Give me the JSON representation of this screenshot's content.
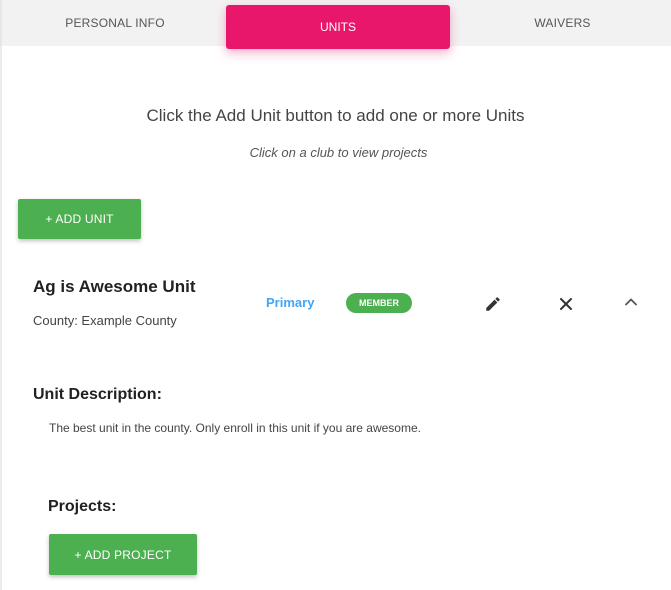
{
  "tabs": [
    {
      "label": "PERSONAL INFO",
      "active": false
    },
    {
      "label": "UNITS",
      "active": true
    },
    {
      "label": "WAIVERS",
      "active": false
    }
  ],
  "intro": {
    "title": "Click the Add Unit button to add one or more Units",
    "hint": "Click on a club to view projects"
  },
  "add_unit_label": "+ ADD UNIT",
  "unit": {
    "name": "Ag is Awesome Unit",
    "county": "County: Example County",
    "primary_label": "Primary",
    "badge": "MEMBER",
    "actions": {
      "edit_icon": "pencil-icon",
      "remove_icon": "close-icon",
      "collapse_icon": "chevron-up-icon"
    },
    "description_heading": "Unit Description:",
    "description": "The best unit in the county. Only enroll in this unit if you are awesome.",
    "projects_heading": "Projects:",
    "add_project_label": "+ ADD PROJECT"
  },
  "colors": {
    "active_tab": "#e8176c",
    "green": "#4caf50",
    "primary_link": "#42a5f5"
  }
}
